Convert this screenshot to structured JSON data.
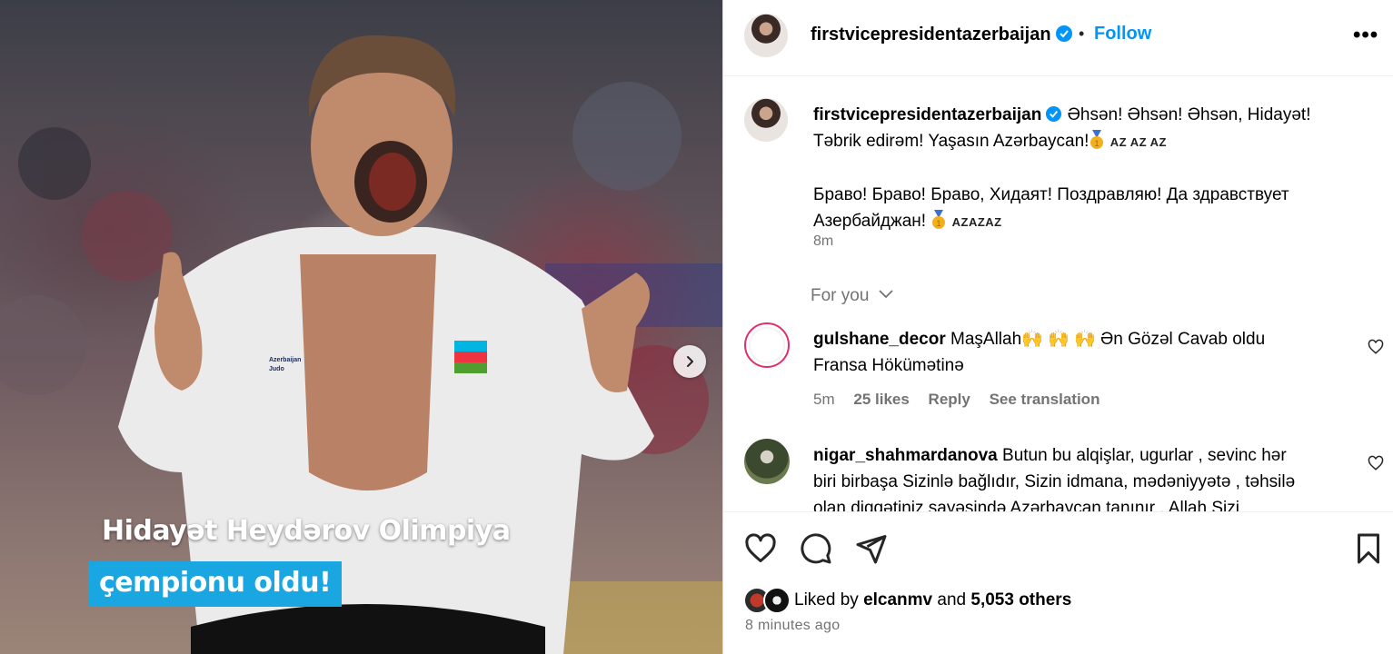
{
  "media": {
    "caption_line1": "Hidayət Heydərov Olimpiya",
    "caption_line2": "çempionu oldu!",
    "flag_label_line1": "Azerbaijan",
    "flag_label_line2": "Judo",
    "next_icon": "chevron-right-icon"
  },
  "header": {
    "username": "firstvicepresidentazerbaijan",
    "separator": "•",
    "follow_label": "Follow",
    "more_label": "•••"
  },
  "caption": {
    "username": "firstvicepresidentazerbaijan",
    "line1": "Əhsən! Əhsən! Əhsən, Hidayət!",
    "line2": "Təbrik edirəm! Yaşasın Azərbaycan!",
    "flags1": "AZ AZ AZ",
    "line3": "Браво! Браво! Браво, Хидаят! Поздравляю! Да здравствует",
    "line4": "Азербайджан!",
    "flags2": "AZAZAZ",
    "time": "8m"
  },
  "for_you": {
    "label": "For you"
  },
  "comments": [
    {
      "username": "gulshane_decor",
      "text_a": "MaşAllah",
      "text_b": "Ən Gözəl Cavab oldu",
      "text_c": "Fransa Hökümətinə",
      "time": "5m",
      "likes": "25 likes",
      "reply": "Reply",
      "translate": "See translation"
    },
    {
      "username": "nigar_shahmardanova",
      "line1": "Butun bu alqişlar, ugurlar , sevinc hər",
      "line2": "biri birbaşa Sizinlə bağlıdır, Sizin idmana, mədəniyyətə , təhsilə",
      "line3": "olan diqqətiniz sayəsində Azərbaycan tanınır , Allah Sizi"
    }
  ],
  "likes": {
    "prefix": "Liked by",
    "user": "elcanmv",
    "and": "and",
    "others": "5,053 others"
  },
  "posted": "8 minutes ago",
  "colors": {
    "accent": "#0095f6",
    "caption_bg": "#1aa6e0",
    "muted": "#737373"
  }
}
